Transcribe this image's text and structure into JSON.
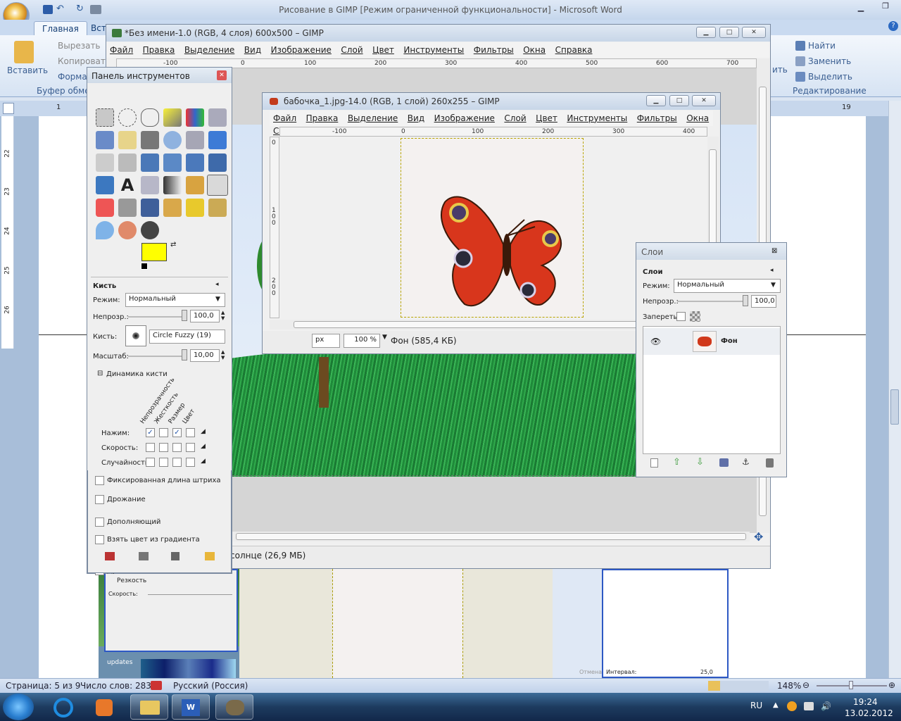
{
  "word": {
    "title": "Рисование в GIMP [Режим ограниченной функциональности] - Microsoft Word",
    "tabs": [
      "Главная",
      "Вст"
    ],
    "clipboard": {
      "paste": "Вставить",
      "cut": "Вырезать",
      "copy": "Копировать",
      "format": "Формат",
      "group": "Буфер обмен"
    },
    "editing": {
      "find": "Найти",
      "replace": "Заменить",
      "select": "Выделить",
      "group": "Редактирование",
      "frag": "ить"
    },
    "ruler_marks": [
      "1",
      "19"
    ],
    "vruler_marks": [
      "22",
      "23",
      "24",
      "25",
      "26"
    ],
    "status": {
      "page": "Страница: 5 из 9",
      "words": "Число слов: 283",
      "lang": "Русский (Россия)",
      "zoom": "148%"
    }
  },
  "taskbar": {
    "lang": "RU",
    "time": "19:24",
    "date": "13.02.2012"
  },
  "gimp_main": {
    "title": "*Без имени-1.0 (RGB, 4 слоя) 600x500 – GIMP",
    "menu": [
      "Файл",
      "Правка",
      "Выделение",
      "Вид",
      "Изображение",
      "Слой",
      "Цвет",
      "Инструменты",
      "Фильтры",
      "Окна",
      "Справка"
    ],
    "ruler": [
      "-100",
      "0",
      "100",
      "200",
      "300",
      "400",
      "500",
      "600",
      "700"
    ],
    "status": "солнце (26,9 МБ)"
  },
  "gimp_butterfly": {
    "title": "бабочка_1.jpg-14.0 (RGB, 1 слой) 260x255 – GIMP",
    "menu": [
      "Файл",
      "Правка",
      "Выделение",
      "Вид",
      "Изображение",
      "Слой",
      "Цвет",
      "Инструменты",
      "Фильтры",
      "Окна",
      "Справка"
    ],
    "ruler": [
      "-100",
      "0",
      "100",
      "200",
      "300",
      "400"
    ],
    "vruler": [
      "0",
      "1\n0\n0",
      "2\n0\n0"
    ],
    "unit": "px",
    "zoom": "100 %",
    "info": "Фон (585,4 КБ)"
  },
  "toolbox": {
    "title": "Панель инструментов",
    "section": "Кисть",
    "mode_label": "Режим:",
    "mode": "Нормальный",
    "opacity_label": "Непрозр.:",
    "opacity": "100,0",
    "brush_label": "Кисть:",
    "brush": "Circle Fuzzy (19)",
    "scale_label": "Масштаб:",
    "scale": "10,00",
    "dynamics": "Динамика кисти",
    "dyn_cols": [
      "Непрозрачность",
      "Жесткость",
      "Размер",
      "Цвет"
    ],
    "dyn_rows": [
      {
        "label": "Нажим:",
        "checks": [
          true,
          false,
          true,
          false
        ]
      },
      {
        "label": "Скорость:",
        "checks": [
          false,
          false,
          false,
          false
        ]
      },
      {
        "label": "Случайность",
        "checks": [
          false,
          false,
          false,
          false
        ]
      }
    ],
    "options": [
      "Фиксированная длина штриха",
      "Дрожание",
      "Дополняющий",
      "Взять цвет из градиента"
    ],
    "fg_color": "#ffff00",
    "bg_color": "#dbe6ef"
  },
  "layers": {
    "title": "Слои",
    "section": "Слои",
    "mode_label": "Режим:",
    "mode": "Нормальный",
    "opacity_label": "Непрозр.:",
    "opacity": "100,0",
    "lock_label": "Запереть:",
    "layer_name": "Фон"
  },
  "bg_fragments": {
    "sharp": "Резкость",
    "speed": "Скорость:",
    "interval": "Интервал:",
    "interval_val": "25,0",
    "updates": "updates",
    "undo": "Отмена"
  }
}
